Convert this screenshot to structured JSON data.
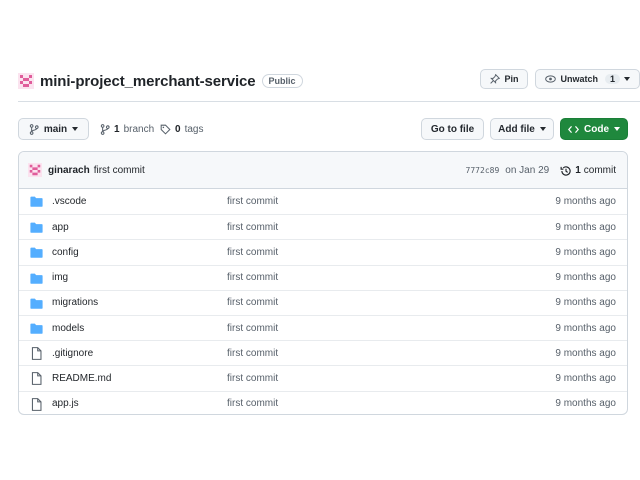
{
  "repo": {
    "name": "mini-project_merchant-service",
    "visibility": "Public",
    "pin_label": "Pin",
    "watch_label": "Unwatch",
    "watch_count": "1"
  },
  "toolbar": {
    "branch": "main",
    "branch_count": "1",
    "branch_word": "branch",
    "tag_count": "0",
    "tag_word": "tags",
    "go_to_file": "Go to file",
    "add_file": "Add file",
    "code": "Code"
  },
  "commit": {
    "author": "ginarach",
    "message": "first commit",
    "sha": "7772c89",
    "date": "on Jan 29",
    "count": "1",
    "count_word": "commit"
  },
  "files": [
    {
      "name": ".vscode",
      "type": "folder",
      "message": "first commit",
      "age": "9 months ago"
    },
    {
      "name": "app",
      "type": "folder",
      "message": "first commit",
      "age": "9 months ago"
    },
    {
      "name": "config",
      "type": "folder",
      "message": "first commit",
      "age": "9 months ago"
    },
    {
      "name": "img",
      "type": "folder",
      "message": "first commit",
      "age": "9 months ago"
    },
    {
      "name": "migrations",
      "type": "folder",
      "message": "first commit",
      "age": "9 months ago"
    },
    {
      "name": "models",
      "type": "folder",
      "message": "first commit",
      "age": "9 months ago"
    },
    {
      "name": ".gitignore",
      "type": "file",
      "message": "first commit",
      "age": "9 months ago"
    },
    {
      "name": "README.md",
      "type": "file",
      "message": "first commit",
      "age": "9 months ago"
    },
    {
      "name": "app.js",
      "type": "file",
      "message": "first commit",
      "age": "9 months ago"
    }
  ],
  "icons": {
    "folder": "folder-icon",
    "file": "file-icon",
    "branch": "git-branch-icon",
    "tag": "tag-icon",
    "history": "history-icon",
    "pin": "pin-icon",
    "eye": "eye-icon",
    "code": "code-icon"
  },
  "colors": {
    "folder": "#54aeff",
    "code_button": "#1f883d",
    "avatar": "#e05d9b"
  }
}
